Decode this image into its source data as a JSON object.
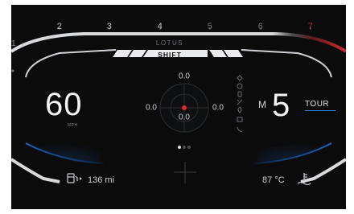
{
  "tachometer": {
    "numbers": [
      "2",
      "3",
      "4",
      "5",
      "6",
      "7"
    ],
    "left_edge_number": "1",
    "redline_color": "#c62b2b"
  },
  "brand": "LOTUS",
  "shift_light": {
    "label": "SHIFT"
  },
  "speed": {
    "value": "60",
    "unit": "MPH"
  },
  "gear": {
    "prefix": "M",
    "value": "5",
    "mode": "TOUR"
  },
  "g_meter": {
    "top": "0.0",
    "left": "0.0",
    "right": "0.0",
    "bottom": "0.0",
    "dot_color": "#e0282d"
  },
  "page_dots": {
    "count": 3,
    "active": 0
  },
  "range": {
    "value": "136 mi"
  },
  "temperature": {
    "value": "87",
    "unit": "°C"
  },
  "colors": {
    "accent_blue": "#2f7fd8",
    "background": "#0b0b0c"
  },
  "status_icons": [
    "diamond-icon",
    "power-icon",
    "seat-icon",
    "no-signal-icon",
    "location-icon",
    "camera-icon",
    "phone-icon"
  ]
}
